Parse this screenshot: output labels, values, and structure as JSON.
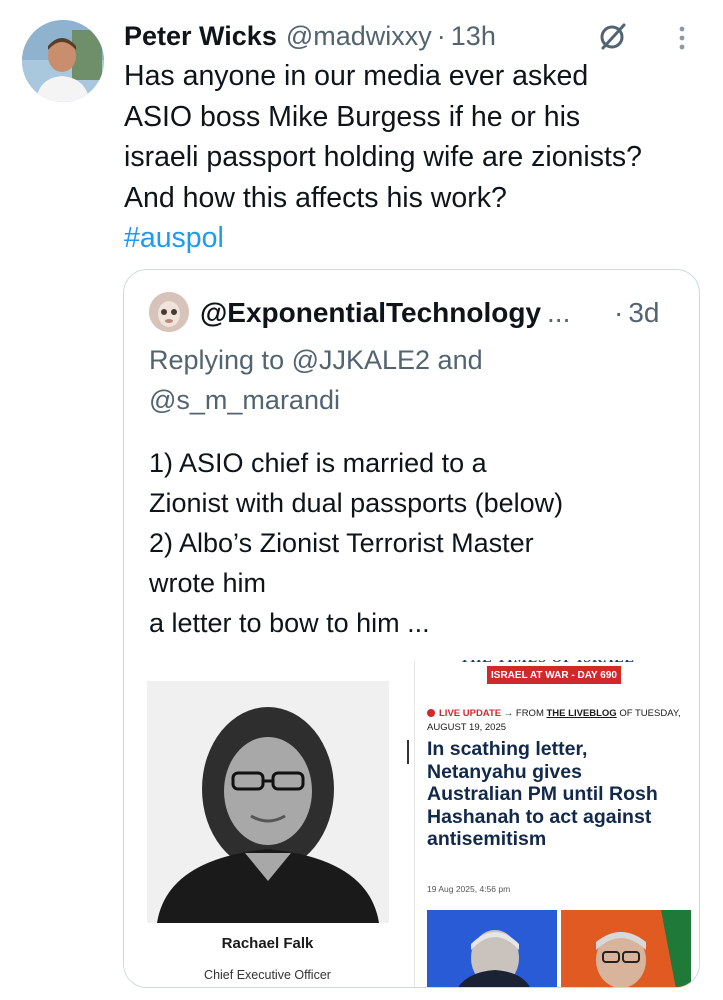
{
  "tweet": {
    "display_name": "Peter Wicks",
    "handle": "@madwixxy",
    "separator": "·",
    "time": "13h",
    "text_lines": [
      "Has anyone in our media ever asked",
      "ASIO boss Mike Burgess if he or his",
      "israeli passport holding wife are zionists?",
      "And how this affects his work?"
    ],
    "hashtag": "#auspol",
    "icons": {
      "avatar": "profile-photo",
      "grok": "grok-icon",
      "more": "more-vertical-icon"
    }
  },
  "quote": {
    "display_name": "@ExponentialTechnology",
    "truncation": "...",
    "separator": "·",
    "time": "3d",
    "replying_lines": [
      "Replying to @JJKALE2 and",
      "@s_m_marandi"
    ],
    "text_lines": [
      "1) ASIO chief is married to a",
      "Zionist with dual passports (below)",
      "2) Albo’s Zionist Terrorist Master",
      "wrote him",
      "a letter to bow to him ..."
    ],
    "media": {
      "left": {
        "person_name": "Rachael Falk",
        "person_title": "Chief Executive Officer"
      },
      "right": {
        "badge": "ISRAEL AT WAR - DAY 690",
        "live_label": "LIVE UPDATE",
        "live_from": "→ FROM",
        "liveblog": "THE LIVEBLOG",
        "live_of": "OF TUESDAY,",
        "live_date": "AUGUST 19, 2025",
        "headline_lines": [
          "In scathing letter,",
          "Netanyahu gives",
          "Australian PM until Rosh",
          "Hashanah to act against",
          "antisemitism"
        ],
        "article_date": "19 Aug 2025, 4:56 pm"
      }
    }
  },
  "colors": {
    "text": "#0f1419",
    "muted": "#536471",
    "link": "#1d9bf0",
    "border": "#cfd9de",
    "badge_red": "#d1282c",
    "headline_navy": "#13294b"
  }
}
